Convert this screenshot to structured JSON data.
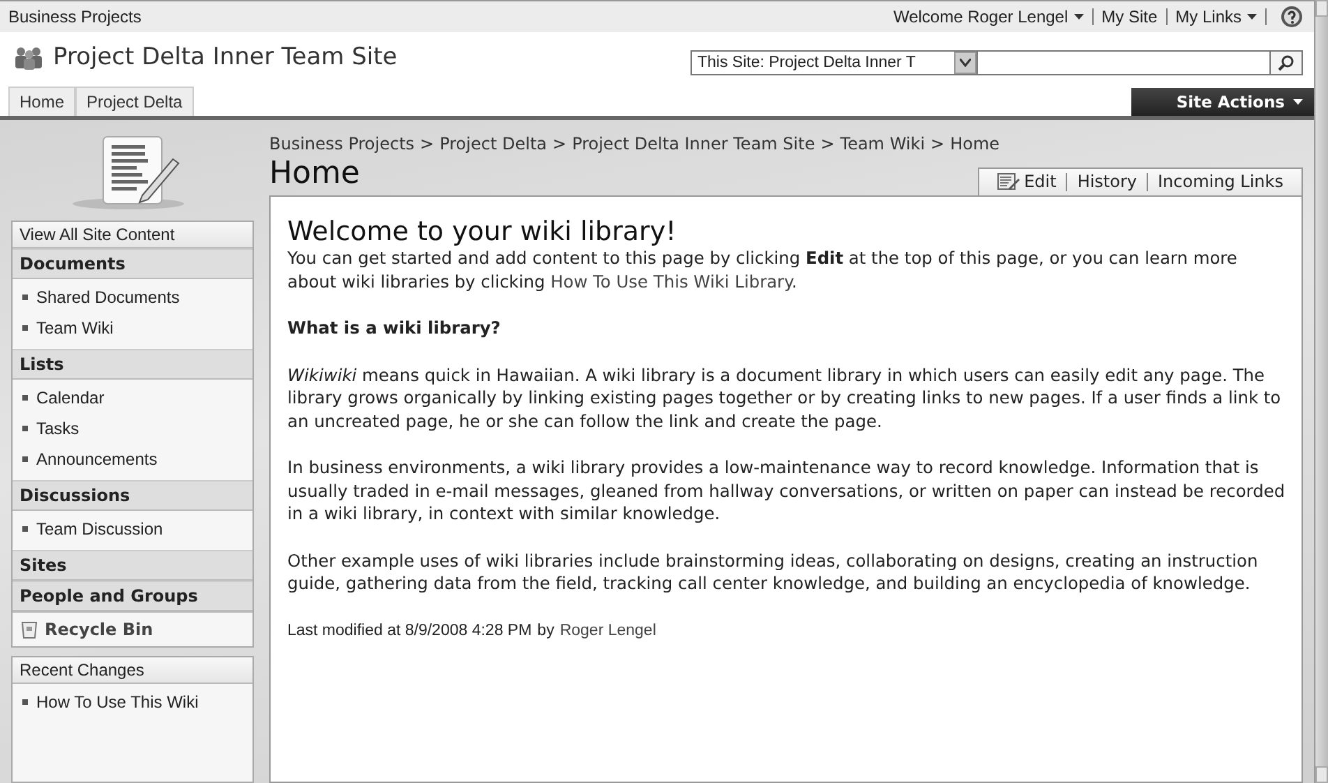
{
  "top_bar": {
    "site": "Business Projects",
    "welcome": "Welcome Roger Lengel",
    "links": [
      {
        "label": "My Site",
        "menu": false
      },
      {
        "label": "My Links",
        "menu": true
      }
    ]
  },
  "header": {
    "title": "Project Delta Inner Team Site"
  },
  "search": {
    "scope": "This Site: Project Delta Inner T"
  },
  "tabs": [
    {
      "label": "Home",
      "selected": false
    },
    {
      "label": "Project Delta",
      "selected": false
    }
  ],
  "site_actions": "Site Actions",
  "breadcrumb": {
    "separator": ">",
    "items": [
      "Business Projects",
      "Project Delta",
      "Project Delta Inner Team Site",
      "Team Wiki",
      "Home"
    ]
  },
  "page_title": "Home",
  "page_actions": [
    {
      "label": "Edit",
      "kind": "edit"
    },
    {
      "label": "History",
      "kind": "plain"
    },
    {
      "label": "Incoming Links",
      "kind": "plain"
    }
  ],
  "sidebar": [
    {
      "kind": "link",
      "label": "View All Site Content"
    },
    {
      "kind": "section",
      "label": "Documents",
      "items": [
        "Shared Documents",
        "Team Wiki"
      ]
    },
    {
      "kind": "section",
      "label": "Lists",
      "items": [
        "Calendar",
        "Tasks",
        "Announcements"
      ]
    },
    {
      "kind": "section",
      "label": "Discussions",
      "items": [
        "Team Discussion"
      ]
    },
    {
      "kind": "section",
      "label": "Sites"
    },
    {
      "kind": "section",
      "label": "People and Groups"
    },
    {
      "kind": "recycle",
      "label": "Recycle Bin"
    }
  ],
  "recent_changes": {
    "title": "Recent Changes",
    "items": [
      "How To Use This Wiki"
    ]
  },
  "content": {
    "heading": "Welcome to your wiki library!",
    "intro": [
      {
        "kind": "text",
        "text": "You can get started and add content to this page by clicking **Edit** at the top of this page, or you can learn more about wiki libraries by clicking "
      },
      {
        "kind": "link",
        "text": "How To Use This Wiki Library"
      },
      {
        "kind": "text",
        "text": "."
      }
    ],
    "subheading": "What is a wiki library?",
    "paragraphs": [
      "*Wikiwiki* means quick in Hawaiian. A wiki library is a document library in which users can easily edit any page. The library grows organically by linking existing pages together or by creating links to new pages. If a user finds a link to an uncreated page, he or she can follow the link and create the page.",
      "In business environments, a wiki library provides a low-maintenance way to record knowledge. Information that is usually traded in e-mail messages, gleaned from hallway conversations, or written on paper can instead be recorded in a wiki library, in context with similar knowledge.",
      "Other example uses of wiki libraries include brainstorming ideas, collaborating on designs, creating an instruction guide, gathering data from the field, tracking call center knowledge, and building an encyclopedia of knowledge."
    ],
    "modified": "Last modified at 8/9/2008 4:28 PM",
    "modified_by_label": "by",
    "modified_by": "Roger Lengel"
  }
}
